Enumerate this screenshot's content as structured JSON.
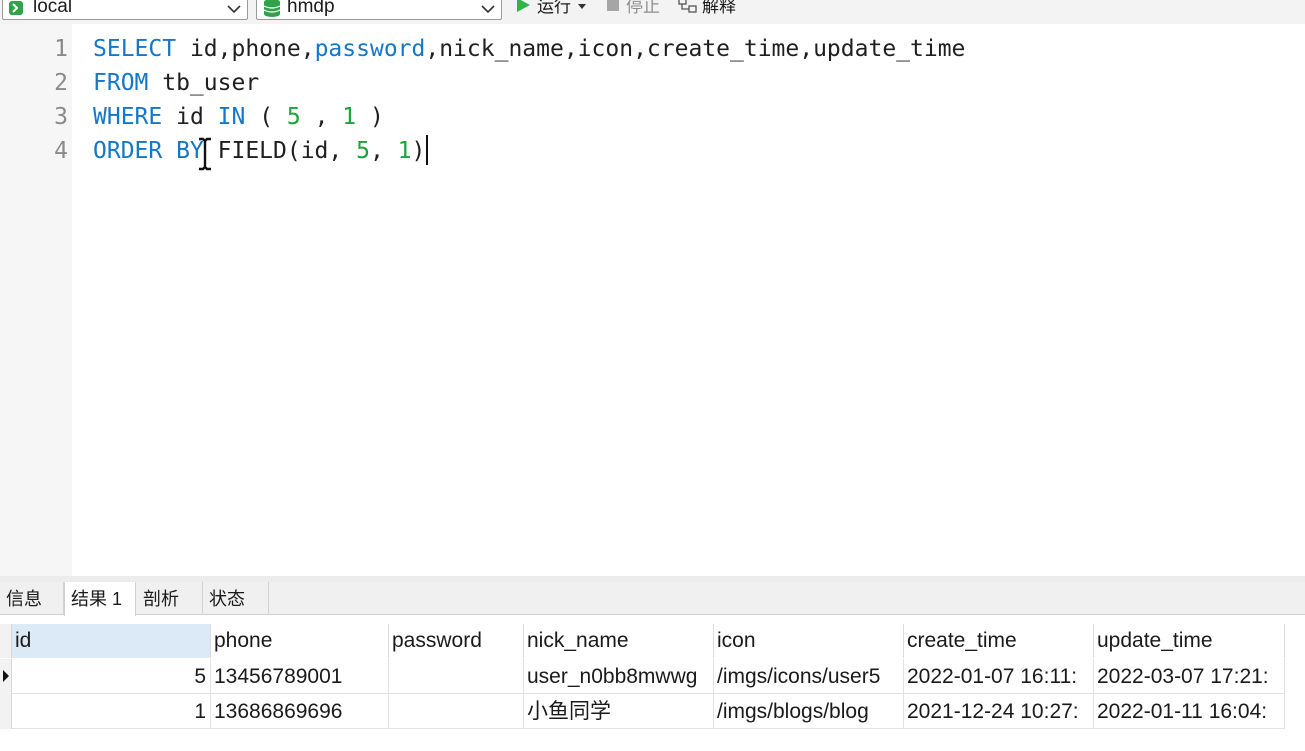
{
  "toolbar": {
    "connection": "local",
    "database": "hmdp",
    "run_label": "运行",
    "stop_label": "停止",
    "explain_label": "解释"
  },
  "editor": {
    "line_numbers": [
      "1",
      "2",
      "3",
      "4"
    ],
    "lines": [
      [
        {
          "t": "SELECT",
          "c": "kw"
        },
        {
          "t": " id,phone,",
          "c": ""
        },
        {
          "t": "password",
          "c": "kw"
        },
        {
          "t": ",nick_name,icon,create_time,update_time",
          "c": ""
        }
      ],
      [
        {
          "t": "FROM",
          "c": "kw"
        },
        {
          "t": " tb_user",
          "c": ""
        }
      ],
      [
        {
          "t": "WHERE",
          "c": "kw"
        },
        {
          "t": " id ",
          "c": ""
        },
        {
          "t": "IN",
          "c": "kw"
        },
        {
          "t": " ( ",
          "c": ""
        },
        {
          "t": "5",
          "c": "num"
        },
        {
          "t": " , ",
          "c": ""
        },
        {
          "t": "1",
          "c": "num"
        },
        {
          "t": " )",
          "c": ""
        }
      ],
      [
        {
          "t": "ORDER BY",
          "c": "kw"
        },
        {
          "t": " FIELD(id, ",
          "c": ""
        },
        {
          "t": "5",
          "c": "num"
        },
        {
          "t": ", ",
          "c": ""
        },
        {
          "t": "1",
          "c": "num"
        },
        {
          "t": ")",
          "c": ""
        }
      ]
    ]
  },
  "result_tabs": [
    "信息",
    "结果 1",
    "剖析",
    "状态"
  ],
  "active_tab": "结果 1",
  "result": {
    "columns": [
      "id",
      "phone",
      "password",
      "nick_name",
      "icon",
      "create_time",
      "update_time"
    ],
    "rows": [
      [
        "5",
        "13456789001",
        "",
        "user_n0bb8mwwg",
        "/imgs/icons/user5",
        "2022-01-07 16:11:",
        "2022-03-07 17:21:"
      ],
      [
        "1",
        "13686869696",
        "",
        "小鱼同学",
        "/imgs/blogs/blog",
        "2021-12-24 10:27:",
        "2022-01-11 16:04:"
      ]
    ]
  },
  "colors": {
    "keyword": "#1477c8",
    "number": "#19a53b",
    "run_icon": "#2fb44a",
    "db_icon": "#2fa24a"
  },
  "icons": {
    "connection": "connection-plug-icon",
    "database": "database-cylinder-icon",
    "run": "play-icon",
    "stop": "stop-square-icon",
    "explain": "explain-icon"
  }
}
